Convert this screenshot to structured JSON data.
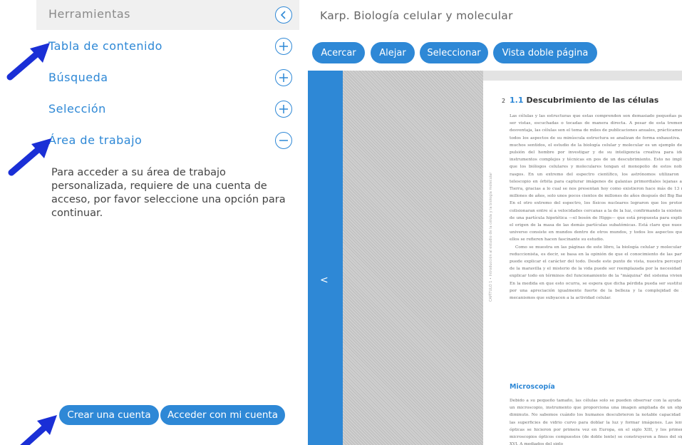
{
  "left_panel": {
    "tools_title": "Herramientas",
    "menu": [
      {
        "label": "Tabla de contenido",
        "icon": "plus-circle-icon"
      },
      {
        "label": "Búsqueda",
        "icon": "plus-circle-icon"
      },
      {
        "label": "Selección",
        "icon": "plus-circle-icon"
      },
      {
        "label": "Área de trabajo",
        "icon": "minus-circle-icon"
      }
    ],
    "workspace_message": "Para acceder a su área de trabajo personalizada, requiere de una cuenta de acceso, por favor seleccione una opción para continuar.",
    "create_account": "Crear una cuenta",
    "login": "Acceder con mi cuenta"
  },
  "viewer": {
    "book_title": "Karp. Biología celular y molecular",
    "toolbar": {
      "zoom_in": "Acercar",
      "zoom_out": "Alejar",
      "select": "Seleccionar",
      "double_page": "Vista doble página"
    },
    "page": {
      "page_number": "2",
      "section_number": "1.1",
      "section_title": "Descubrimiento de las células",
      "vertical_caption": "CAPÍTULO 1 • Introducción al estudio de la célula y la biología molecular",
      "para1": "Las células y las estructuras que estas comprenden son demasiado pequeñas para ser vistas, escuchadas o tocadas de manera directa. A pesar de esta tremenda desventaja, las células son el tema de miles de publicaciones anuales, prácticamente todos los aspectos de su minúscula estructura se analizan de forma exhaustiva. En muchos sentidos, el estudio de la biología celular y molecular es un ejemplo de la pulsión del hombre por investigar y de su inteligencia creativa para idear instrumentos complejos y técnicas en pos de un descubrimiento. Esto no implica que los biólogos celulares y moleculares tengan el monopolio de estos nobles rasgos. En un extremo del espectro científico, los astrónomos utilizaron un telescopio en órbita para capturar imágenes de galaxias primordiales lejanas a la Tierra, gracias a lo cual se nos presentan hoy como existieron hace más de 13 mil millones de años, solo unos pocos cientos de millones de años después del Big Bang. En el otro extremo del espectro, los físicos nucleares lograron que los protones colisionaran entre sí a velocidades cercanas a la de la luz, confirmando la existencia de una partícula hipotética —el bosón de Higgs— que está propuesta para explicar el origen de la masa de las demás partículas subatómicas. Está claro que nuestro universo consiste en mundos dentro de otros mundos, y todos los aspectos que a ellos se refieren hacen fascinante su estudio.",
      "para2": "Como se muestra en las páginas de este libro, la biología celular y molecular es reduccionista, es decir, se basa en la opinión de que el conocimiento de las partes puede explicar el carácter del todo. Desde este punto de vista, nuestra percepción de la maravilla y el misterio de la vida puede ser reemplazada por la necesidad de explicar todo en términos del funcionamiento de la \"máquina\" del sistema viviente. En la medida en que esto ocurra, se espera que dicha pérdida pueda ser sustituida por una apreciación igualmente fuerte de la belleza y la complejidad de los mecanismos que subyacen a la actividad celular.",
      "subsection_title": "Microscopía",
      "para3": "Debido a su pequeño tamaño, las células solo se pueden observar con la ayuda de un microscopio, instrumento que proporciona una imagen ampliada de un objeto diminuto. No sabemos cuándo los humanos descubrieron la notable capacidad de las superficies de vidrio curvo para doblar la luz y formar imágenes. Las lentes ópticas se hicieron por primera vez en Europa, en el siglo XIII, y los primeros microscopios ópticos compuestos (de doble lente) se construyeron a fines del siglo XVI. A mediados del siglo"
    },
    "nav_chevron": "<"
  },
  "colors": {
    "accent": "#2e88d6",
    "arrow": "#1a2fd6"
  }
}
